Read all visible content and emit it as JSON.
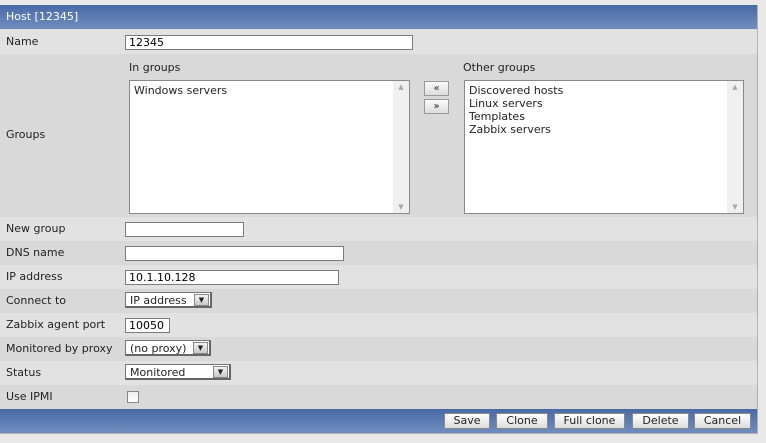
{
  "header": {
    "title": "Host  [12345]"
  },
  "fields": {
    "name": {
      "label": "Name",
      "value": "12345"
    },
    "groups": {
      "label": "Groups",
      "in_label": "In groups",
      "in": [
        "Windows servers"
      ],
      "other_label": "Other groups",
      "other": [
        "Discovered hosts",
        "Linux servers",
        "Templates",
        "Zabbix servers"
      ],
      "move_left": "«",
      "move_right": "»"
    },
    "new_group": {
      "label": "New group",
      "value": ""
    },
    "dns": {
      "label": "DNS name",
      "value": ""
    },
    "ip": {
      "label": "IP address",
      "value": "10.1.10.128"
    },
    "connect": {
      "label": "Connect to",
      "value": "IP address"
    },
    "port": {
      "label": "Zabbix agent port",
      "value": "10050"
    },
    "proxy": {
      "label": "Monitored by proxy",
      "value": "(no proxy)"
    },
    "status": {
      "label": "Status",
      "value": "Monitored"
    },
    "ipmi": {
      "label": "Use IPMI",
      "checked": false
    }
  },
  "buttons": {
    "save": "Save",
    "clone": "Clone",
    "full_clone": "Full clone",
    "delete": "Delete",
    "cancel": "Cancel"
  }
}
